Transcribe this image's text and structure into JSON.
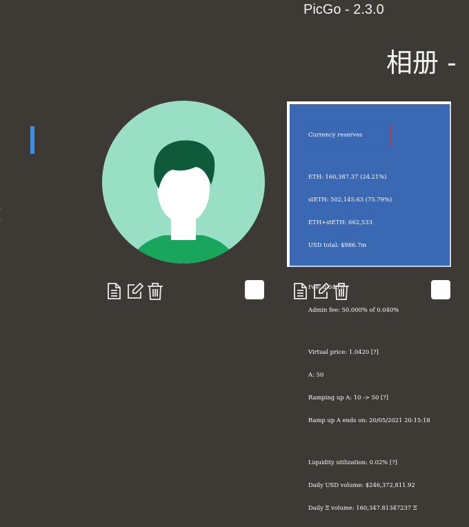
{
  "window": {
    "title": "PicGo - 2.3.0"
  },
  "page": {
    "title": "相册 - ",
    "accent_color": "#3d8fe6"
  },
  "gallery": {
    "items": [
      {
        "kind": "default-avatar",
        "colors": {
          "background": "#98dfc5",
          "hair": "#0f5a3a",
          "shirt": "#19a55b",
          "face": "#ffffff"
        },
        "actions": [
          "file-icon",
          "edit-icon",
          "delete-icon"
        ],
        "checked": false
      },
      {
        "kind": "screenshot",
        "lines": [
          "Currency reserves",
          "",
          "ETH: 160,387.37 (24.21%)",
          "stETH: 502,145.63 (75.79%)",
          "ETH+stETH: 662,533",
          "USD total: $986.7m",
          "",
          "Fee: 0.040%",
          "Admin fee: 50.000% of 0.040%",
          "",
          "Virtual price: 1.0420 [?]",
          "A: 50",
          "Ramping up A: 10 -> 50 [?]",
          "Ramp up A ends on: 20/05/2021 20:15:18",
          "",
          "Liquidity utilization: 0.02% [?]",
          "Daily USD volume: $246,372,811.92",
          "Daily Ξ volume: 160,347.81347237 Ξ"
        ],
        "colors": {
          "background": "#3a68b3",
          "highlight": "#b83a4a"
        },
        "actions": [
          "file-icon",
          "edit-icon",
          "delete-icon"
        ],
        "checked": false
      }
    ]
  }
}
